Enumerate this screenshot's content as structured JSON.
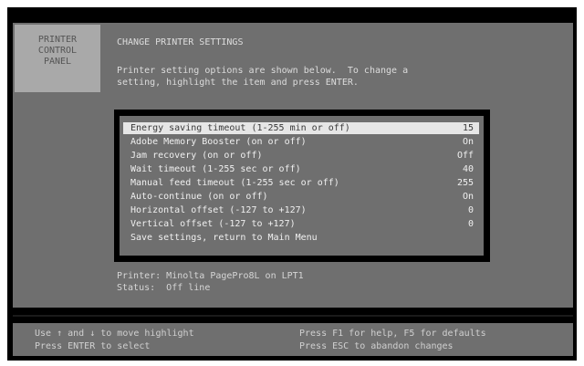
{
  "sidebar": {
    "logo_lines": [
      "PRINTER",
      "CONTROL",
      "PANEL"
    ]
  },
  "header": {
    "title": "CHANGE PRINTER SETTINGS",
    "description_lines": [
      "Printer setting options are shown below.  To change a",
      "setting, highlight the item and press ENTER."
    ]
  },
  "menu": {
    "items": [
      {
        "label": "Energy saving timeout (1-255 min or off)",
        "value": "15",
        "selected": true
      },
      {
        "label": "Adobe Memory Booster (on or off)",
        "value": "On",
        "selected": false
      },
      {
        "label": "Jam recovery (on or off)",
        "value": "Off",
        "selected": false
      },
      {
        "label": "Wait timeout (1-255 sec or off)",
        "value": "40",
        "selected": false
      },
      {
        "label": "Manual feed timeout (1-255 sec or off)",
        "value": "255",
        "selected": false
      },
      {
        "label": "Auto-continue (on or off)",
        "value": "On",
        "selected": false
      },
      {
        "label": "Horizontal offset (-127 to +127)",
        "value": "0",
        "selected": false
      },
      {
        "label": "Vertical offset (-127 to +127)",
        "value": "0",
        "selected": false
      },
      {
        "label": "Save settings, return to Main Menu",
        "value": "",
        "selected": false
      }
    ]
  },
  "status": {
    "printer_line": "Printer: Minolta PagePro8L on LPT1",
    "status_line": "Status:  Off line"
  },
  "help": {
    "left_line1": "Use ↑ and ↓ to move highlight",
    "left_line2": "Press ENTER to select",
    "right_line1": "Press F1 for help, F5 for defaults",
    "right_line2": "Press ESC to abandon changes"
  },
  "colors": {
    "panel_bg": "#6f6f6f",
    "screen_bg": "#000000",
    "highlight_bg": "#e6e6e6"
  }
}
